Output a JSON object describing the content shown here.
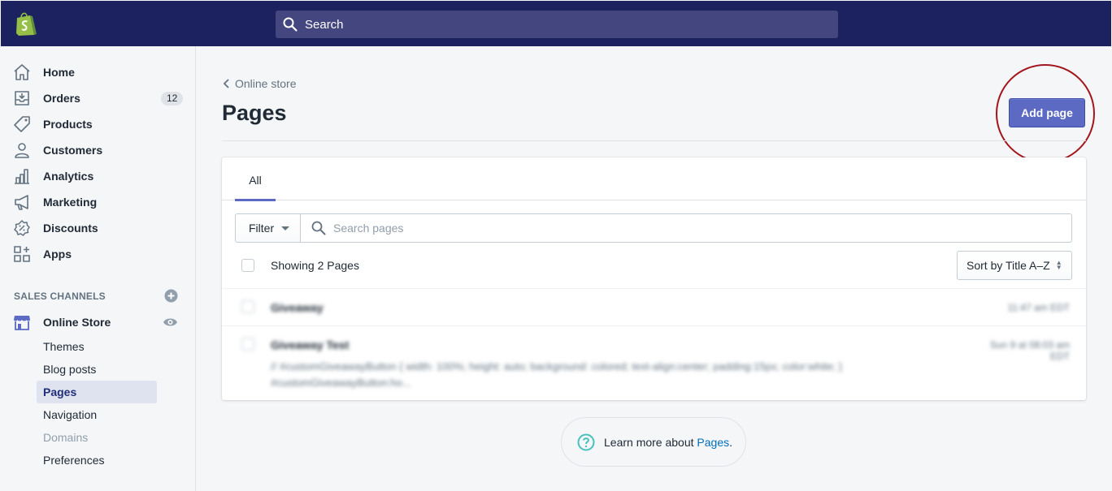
{
  "topbar": {
    "logo_icon": "shopify-bag-icon",
    "search_placeholder": "Search"
  },
  "sidebar": {
    "items": [
      {
        "label": "Home",
        "icon": "home-icon"
      },
      {
        "label": "Orders",
        "icon": "orders-icon",
        "badge": "12"
      },
      {
        "label": "Products",
        "icon": "tag-icon"
      },
      {
        "label": "Customers",
        "icon": "person-icon"
      },
      {
        "label": "Analytics",
        "icon": "bar-chart-icon"
      },
      {
        "label": "Marketing",
        "icon": "megaphone-icon"
      },
      {
        "label": "Discounts",
        "icon": "discount-icon"
      },
      {
        "label": "Apps",
        "icon": "apps-icon"
      }
    ],
    "sales_channels_title": "SALES CHANNELS",
    "online_store": {
      "label": "Online Store",
      "icon": "store-icon",
      "sub_items": [
        {
          "label": "Themes"
        },
        {
          "label": "Blog posts"
        },
        {
          "label": "Pages",
          "active": true
        },
        {
          "label": "Navigation"
        },
        {
          "label": "Domains",
          "disabled": true
        },
        {
          "label": "Preferences"
        }
      ]
    }
  },
  "main": {
    "breadcrumb": "Online store",
    "title": "Pages",
    "add_button": "Add page",
    "tabs": [
      {
        "label": "All"
      }
    ],
    "filter_label": "Filter",
    "search_placeholder": "Search pages",
    "showing": "Showing 2 Pages",
    "sort_label": "Sort by Title A–Z",
    "rows": [
      {
        "title": "Giveaway",
        "date": "11:47 am EDT"
      },
      {
        "title": "Giveaway Test",
        "date": "Sun 9 at 08:03 am EDT",
        "excerpt": "// #customGiveawayButton { width: 100%; height: auto; background: colored; text-align:center; padding:15px; color:white; } #customGiveawayButton:ho..."
      }
    ],
    "help_prefix": "Learn more about ",
    "help_link": "Pages",
    "help_suffix": "."
  },
  "colors": {
    "topbar": "#1c2260",
    "primary_button": "#5c6ac4",
    "highlight_circle": "#a3151c",
    "link": "#006fbb"
  }
}
